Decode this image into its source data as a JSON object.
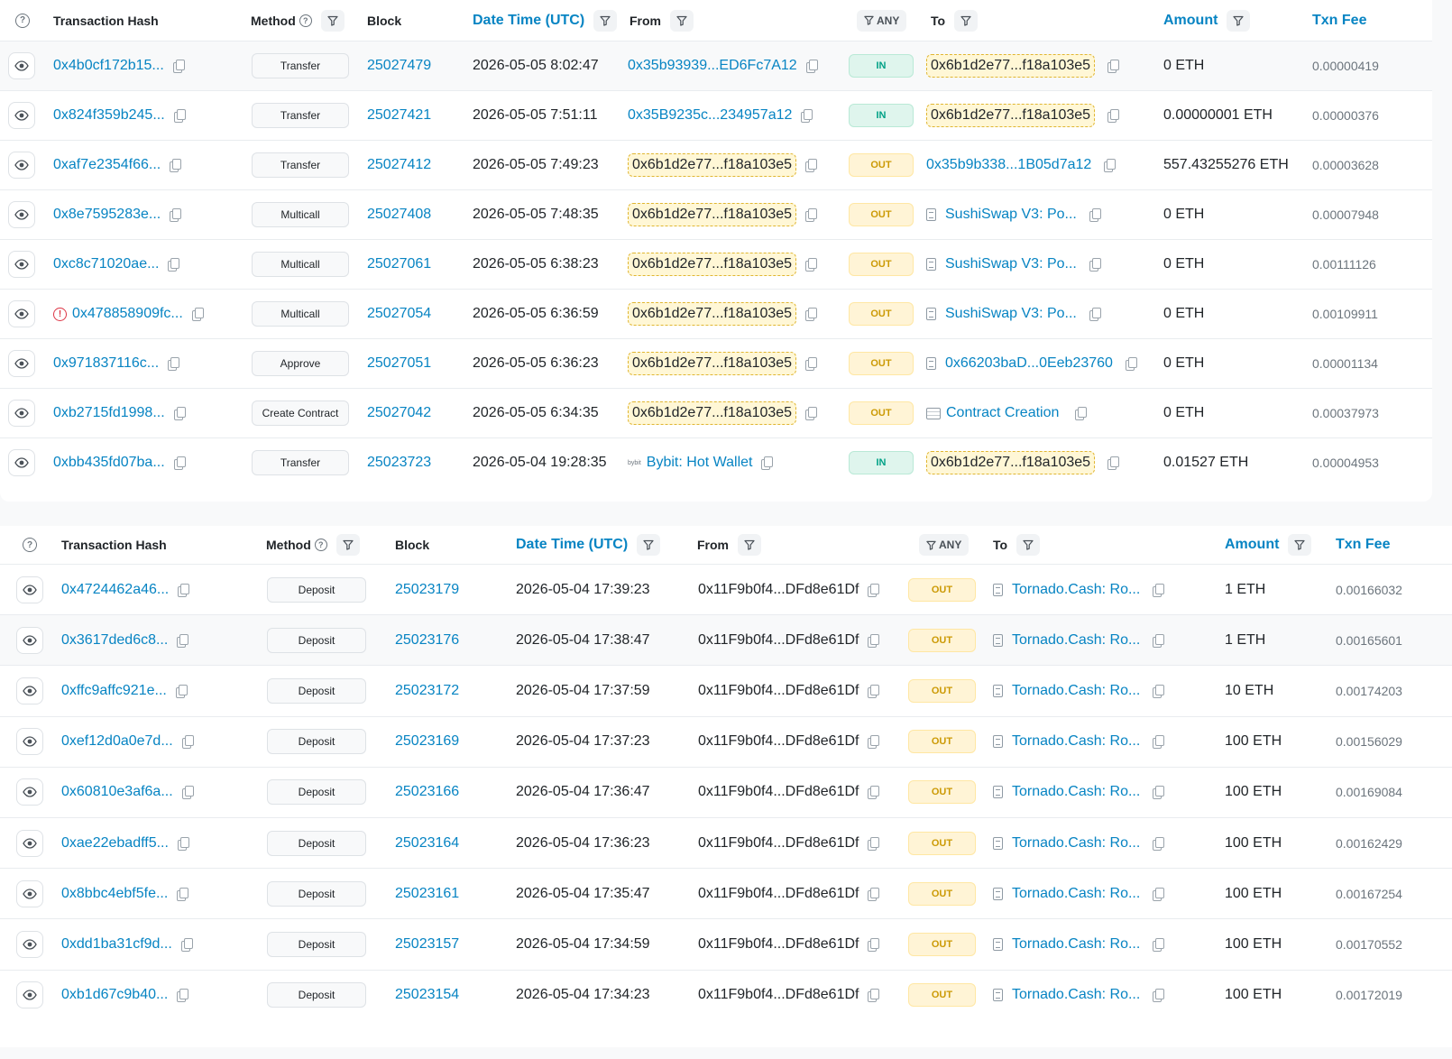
{
  "top_table": {
    "headers": {
      "help_icon": "?",
      "tx_hash": "Transaction Hash",
      "method": "Method",
      "block": "Block",
      "datetime": "Date Time (UTC)",
      "from": "From",
      "any": "ANY",
      "to": "To",
      "amount": "Amount",
      "fee": "Txn Fee"
    },
    "rows": [
      {
        "hash": "0x4b0cf172b15...",
        "method": "Transfer",
        "block": "25027479",
        "time": "2026-05-05 8:02:47",
        "from": "0x35b93939...ED6Fc7A12",
        "from_style": "link",
        "dir": "IN",
        "to": "0x6b1d2e77...f18a103e5",
        "to_style": "highlight",
        "amount": "0 ETH",
        "fee": "0.00000419"
      },
      {
        "hash": "0x824f359b245...",
        "method": "Transfer",
        "block": "25027421",
        "time": "2026-05-05 7:51:11",
        "from": "0x35B9235c...234957a12",
        "from_style": "link",
        "dir": "IN",
        "to": "0x6b1d2e77...f18a103e5",
        "to_style": "highlight",
        "amount": "0.00000001 ETH",
        "fee": "0.00000376"
      },
      {
        "hash": "0xaf7e2354f66...",
        "method": "Transfer",
        "block": "25027412",
        "time": "2026-05-05 7:49:23",
        "from": "0x6b1d2e77...f18a103e5",
        "from_style": "highlight",
        "dir": "OUT",
        "to": "0x35b9b338...1B05d7a12",
        "to_style": "link",
        "amount": "557.43255276 ETH",
        "fee": "0.00003628"
      },
      {
        "hash": "0x8e7595283e...",
        "method": "Multicall",
        "block": "25027408",
        "time": "2026-05-05 7:48:35",
        "from": "0x6b1d2e77...f18a103e5",
        "from_style": "highlight",
        "dir": "OUT",
        "to": "SushiSwap V3: Po...",
        "to_style": "contract",
        "amount": "0 ETH",
        "fee": "0.00007948"
      },
      {
        "hash": "0xc8c71020ae...",
        "method": "Multicall",
        "block": "25027061",
        "time": "2026-05-05 6:38:23",
        "from": "0x6b1d2e77...f18a103e5",
        "from_style": "highlight",
        "dir": "OUT",
        "to": "SushiSwap V3: Po...",
        "to_style": "contract",
        "amount": "0 ETH",
        "fee": "0.00111126"
      },
      {
        "hash": "0x478858909fc...",
        "error": true,
        "method": "Multicall",
        "block": "25027054",
        "time": "2026-05-05 6:36:59",
        "from": "0x6b1d2e77...f18a103e5",
        "from_style": "highlight",
        "dir": "OUT",
        "to": "SushiSwap V3: Po...",
        "to_style": "contract",
        "amount": "0 ETH",
        "fee": "0.00109911"
      },
      {
        "hash": "0x971837116c...",
        "method": "Approve",
        "block": "25027051",
        "time": "2026-05-05 6:36:23",
        "from": "0x6b1d2e77...f18a103e5",
        "from_style": "highlight",
        "dir": "OUT",
        "to": "0x66203baD...0Eeb23760",
        "to_style": "contract",
        "amount": "0 ETH",
        "fee": "0.00001134"
      },
      {
        "hash": "0xb2715fd1998...",
        "method": "Create Contract",
        "block": "25027042",
        "time": "2026-05-05 6:34:35",
        "from": "0x6b1d2e77...f18a103e5",
        "from_style": "highlight",
        "dir": "OUT",
        "to": "Contract Creation",
        "to_style": "creation",
        "amount": "0 ETH",
        "fee": "0.00037973"
      },
      {
        "hash": "0xbb435fd07ba...",
        "method": "Transfer",
        "block": "25023723",
        "time": "2026-05-04 19:28:35",
        "from": "Bybit: Hot Wallet",
        "from_style": "wallet",
        "from_icon_text": "bybit",
        "dir": "IN",
        "to": "0x6b1d2e77...f18a103e5",
        "to_style": "highlight",
        "amount": "0.01527 ETH",
        "fee": "0.00004953"
      }
    ]
  },
  "bottom_table": {
    "headers": {
      "help_icon": "?",
      "tx_hash": "Transaction Hash",
      "method": "Method",
      "block": "Block",
      "datetime": "Date Time (UTC)",
      "from": "From",
      "any": "ANY",
      "to": "To",
      "amount": "Amount",
      "fee": "Txn Fee"
    },
    "rows": [
      {
        "hash": "0x4724462a46...",
        "method": "Deposit",
        "block": "25023179",
        "time": "2026-05-04 17:39:23",
        "from": "0x11F9b0f4...DFd8e61Df",
        "dir": "OUT",
        "to": "Tornado.Cash: Ro...",
        "amount": "1 ETH",
        "fee": "0.00166032"
      },
      {
        "hash": "0x3617ded6c8...",
        "method": "Deposit",
        "block": "25023176",
        "time": "2026-05-04 17:38:47",
        "from": "0x11F9b0f4...DFd8e61Df",
        "dir": "OUT",
        "to": "Tornado.Cash: Ro...",
        "amount": "1 ETH",
        "fee": "0.00165601"
      },
      {
        "hash": "0xffc9affc921e...",
        "method": "Deposit",
        "block": "25023172",
        "time": "2026-05-04 17:37:59",
        "from": "0x11F9b0f4...DFd8e61Df",
        "dir": "OUT",
        "to": "Tornado.Cash: Ro...",
        "amount": "10 ETH",
        "fee": "0.00174203"
      },
      {
        "hash": "0xef12d0a0e7d...",
        "method": "Deposit",
        "block": "25023169",
        "time": "2026-05-04 17:37:23",
        "from": "0x11F9b0f4...DFd8e61Df",
        "dir": "OUT",
        "to": "Tornado.Cash: Ro...",
        "amount": "100 ETH",
        "fee": "0.00156029"
      },
      {
        "hash": "0x60810e3af6a...",
        "method": "Deposit",
        "block": "25023166",
        "time": "2026-05-04 17:36:47",
        "from": "0x11F9b0f4...DFd8e61Df",
        "dir": "OUT",
        "to": "Tornado.Cash: Ro...",
        "amount": "100 ETH",
        "fee": "0.00169084"
      },
      {
        "hash": "0xae22ebadff5...",
        "method": "Deposit",
        "block": "25023164",
        "time": "2026-05-04 17:36:23",
        "from": "0x11F9b0f4...DFd8e61Df",
        "dir": "OUT",
        "to": "Tornado.Cash: Ro...",
        "amount": "100 ETH",
        "fee": "0.00162429"
      },
      {
        "hash": "0x8bbc4ebf5fe...",
        "method": "Deposit",
        "block": "25023161",
        "time": "2026-05-04 17:35:47",
        "from": "0x11F9b0f4...DFd8e61Df",
        "dir": "OUT",
        "to": "Tornado.Cash: Ro...",
        "amount": "100 ETH",
        "fee": "0.00167254"
      },
      {
        "hash": "0xdd1ba31cf9d...",
        "method": "Deposit",
        "block": "25023157",
        "time": "2026-05-04 17:34:59",
        "from": "0x11F9b0f4...DFd8e61Df",
        "dir": "OUT",
        "to": "Tornado.Cash: Ro...",
        "amount": "100 ETH",
        "fee": "0.00170552"
      },
      {
        "hash": "0xb1d67c9b40...",
        "method": "Deposit",
        "block": "25023154",
        "time": "2026-05-04 17:34:23",
        "from": "0x11F9b0f4...DFd8e61Df",
        "dir": "OUT",
        "to": "Tornado.Cash: Ro...",
        "amount": "100 ETH",
        "fee": "0.00172019"
      }
    ]
  },
  "colors": {
    "link": "#0784c3",
    "in_badge": "#00a186",
    "out_badge": "#cc9a06",
    "highlight": "#fff7d6",
    "error": "#dc3545"
  },
  "icons": [
    "eye-icon",
    "copy-icon",
    "filter-icon",
    "help-icon",
    "contract-doc-icon",
    "contract-creation-icon",
    "error-icon",
    "wallet-logo-icon"
  ]
}
